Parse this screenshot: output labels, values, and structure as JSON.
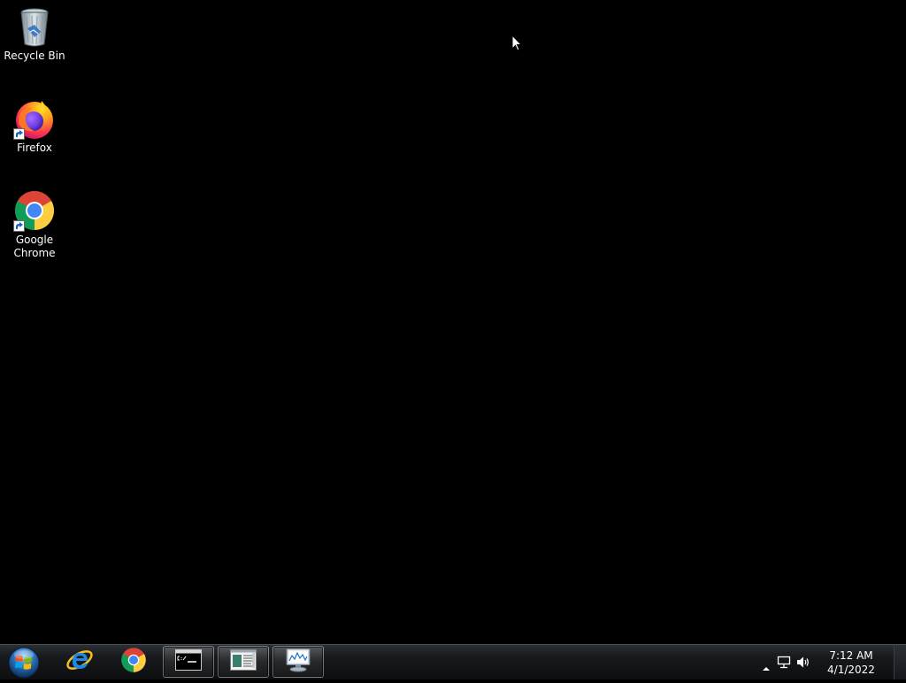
{
  "desktop": {
    "background_color": "#000000",
    "icons": [
      {
        "label": "Recycle Bin",
        "icon": "recycle-bin-icon",
        "shortcut": false
      },
      {
        "label": "Firefox",
        "icon": "firefox-icon",
        "shortcut": true
      },
      {
        "label": "Google Chrome",
        "icon": "chrome-icon",
        "shortcut": true
      }
    ]
  },
  "taskbar": {
    "start_icon": "windows-start-orb-icon",
    "pinned": [
      {
        "icon": "internet-explorer-icon",
        "running": false
      },
      {
        "icon": "chrome-icon",
        "running": false
      },
      {
        "icon": "command-prompt-icon",
        "running": true
      },
      {
        "icon": "document-window-icon",
        "running": true
      },
      {
        "icon": "resource-monitor-icon",
        "running": true
      }
    ],
    "tray": {
      "icons": [
        "show-hidden-icons-arrow-icon",
        "network-icon",
        "volume-icon"
      ],
      "clock": {
        "time": "7:12 AM",
        "date": "4/1/2022"
      }
    }
  }
}
